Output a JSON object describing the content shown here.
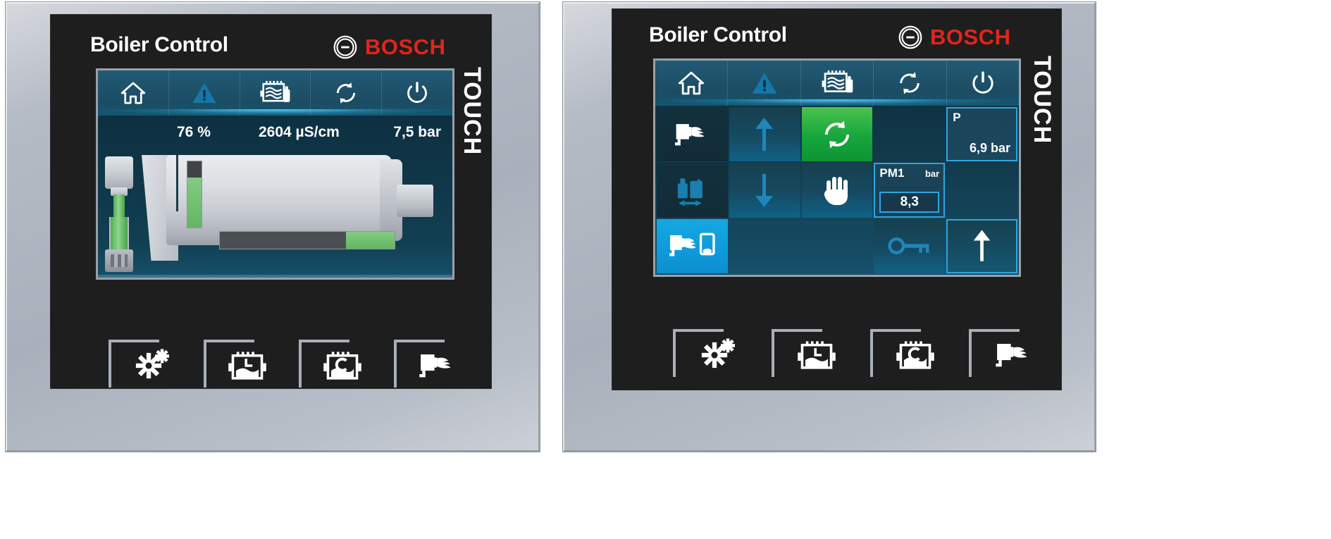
{
  "devices": [
    {
      "id": "left",
      "title": "Boiler Control",
      "brand": {
        "word": "BOSCH",
        "mark": "bosch-supergraphic-icon",
        "color": "#e2241b"
      },
      "touch_label": "TOUCH",
      "nav": [
        {
          "name": "home-icon",
          "label": "Home"
        },
        {
          "name": "alarm-warning-icon",
          "label": "Alarm"
        },
        {
          "name": "trend-recorder-icon",
          "label": "Trend"
        },
        {
          "name": "refresh-cycle-icon",
          "label": "Reset"
        },
        {
          "name": "power-icon",
          "label": "Power"
        }
      ],
      "readouts": [
        {
          "name": "level-percent",
          "value": "76 %"
        },
        {
          "name": "conductivity",
          "value": "2604 µS/cm"
        },
        {
          "name": "pressure",
          "value": "7,5 bar"
        }
      ],
      "boiler": {
        "level_fill_percent": 76,
        "bar_fill_percent": 28,
        "colors": {
          "fill": "#62b663",
          "empty": "#4b4f52",
          "shell": "#dcdfe3"
        }
      },
      "hwkeys": [
        {
          "name": "snowflake-burner-icon",
          "label": "Frost protection"
        },
        {
          "name": "boiler-level-L-icon",
          "label": "Level L"
        },
        {
          "name": "boiler-conductivity-C-icon",
          "label": "Conductivity C"
        },
        {
          "name": "burner-flame-icon",
          "label": "Burner"
        }
      ]
    },
    {
      "id": "right",
      "title": "Boiler Control",
      "brand": {
        "word": "BOSCH",
        "mark": "bosch-supergraphic-icon",
        "color": "#e2241b"
      },
      "touch_label": "TOUCH",
      "nav": [
        {
          "name": "home-icon",
          "label": "Home"
        },
        {
          "name": "alarm-warning-icon",
          "label": "Alarm"
        },
        {
          "name": "trend-recorder-icon",
          "label": "Trend"
        },
        {
          "name": "refresh-cycle-icon",
          "label": "Reset"
        },
        {
          "name": "power-icon",
          "label": "Power"
        }
      ],
      "grid": [
        {
          "name": "burner-flame-button",
          "style": "dark",
          "icon": "burner-flame-icon"
        },
        {
          "name": "arrow-up-button",
          "style": "normal",
          "icon": "arrow-up-icon"
        },
        {
          "name": "cycle-running-button",
          "style": "green",
          "icon": "refresh-cycle-icon"
        },
        {
          "name": "spacer-cell-1",
          "style": "blank",
          "icon": ""
        },
        {
          "name": "pressure-setpoint-readout",
          "style": "pbox",
          "icon": "",
          "kv_name": "P",
          "kv_value": "6,9 bar"
        },
        {
          "name": "feedwater-tank-button",
          "style": "dark",
          "icon": "tank-exchange-icon"
        },
        {
          "name": "arrow-down-button",
          "style": "normal",
          "icon": "arrow-down-icon"
        },
        {
          "name": "manual-hand-button",
          "style": "normal",
          "icon": "hand-icon"
        },
        {
          "name": "pm1-pressure-readout",
          "style": "kv",
          "icon": "",
          "kv_name": "PM1",
          "kv_unit": "bar",
          "kv_value": "8,3"
        },
        {
          "name": "spacer-cell-2",
          "style": "blank",
          "icon": ""
        },
        {
          "name": "burner-control-active-button",
          "style": "cyan",
          "icon": "burner-panel-icon"
        },
        {
          "name": "spacer-cell-3",
          "style": "blank",
          "icon": ""
        },
        {
          "name": "spacer-cell-4",
          "style": "blank",
          "icon": ""
        },
        {
          "name": "key-access-button",
          "style": "normal",
          "icon": "key-icon"
        },
        {
          "name": "back-up-button",
          "style": "outline",
          "icon": "arrow-up-icon"
        }
      ],
      "hwkeys": [
        {
          "name": "snowflake-burner-icon",
          "label": "Frost protection"
        },
        {
          "name": "boiler-level-L-icon",
          "label": "Level L"
        },
        {
          "name": "boiler-conductivity-C-icon",
          "label": "Conductivity C"
        },
        {
          "name": "burner-flame-icon",
          "label": "Burner"
        }
      ]
    }
  ],
  "theme": {
    "bezel": "#b6bcc6",
    "glass": "#1e1e1e",
    "hmi_blue": "#16506a",
    "nav_blue": "#1c4c63",
    "accent_cyan": "#2fa5df",
    "active_cyan": "#0f9ada",
    "running_green": "#16a63d",
    "fill_green": "#62b663",
    "bosch_red": "#e2241b"
  }
}
